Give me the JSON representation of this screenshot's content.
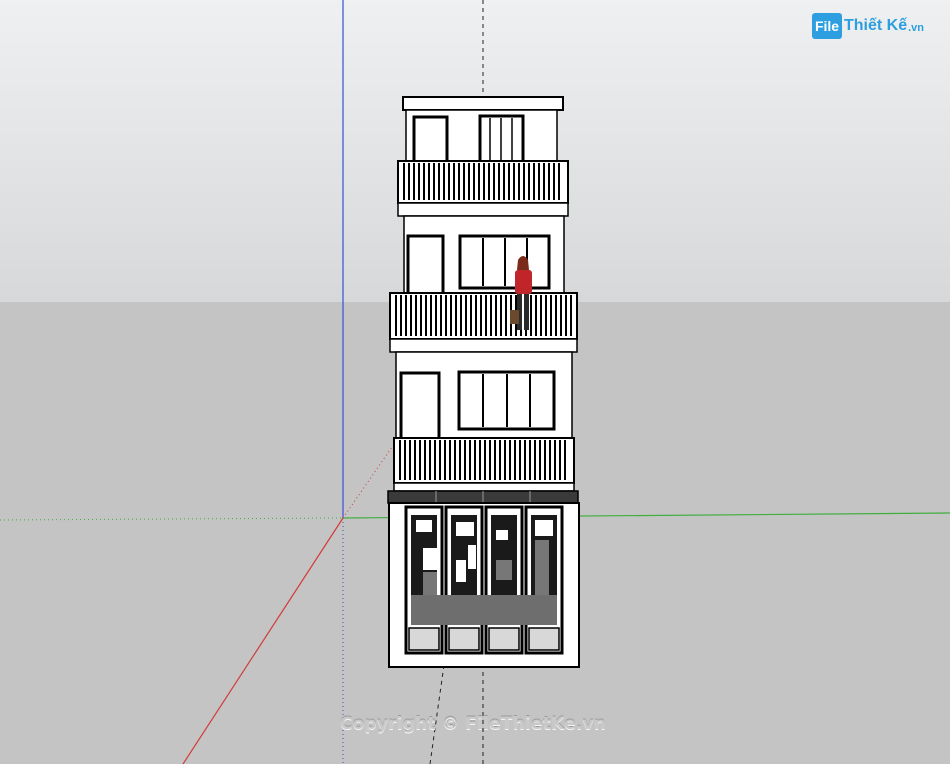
{
  "app": {
    "name": "SketchUp model viewport"
  },
  "watermark": {
    "logo_badge": "File",
    "logo_text": "Thiết Kế",
    "logo_tld": ".vn",
    "copyright": "Copyright © FileThietKe.vn"
  },
  "colors": {
    "sky_top": "#eceef0",
    "sky_bottom": "#d4d6d8",
    "ground": "#c4c4c4",
    "axis_red": "#d23a3a",
    "axis_green": "#3fae3f",
    "axis_blue": "#3a4fd6",
    "accent": "#2d9fe0",
    "figure_shirt": "#c0252a"
  }
}
